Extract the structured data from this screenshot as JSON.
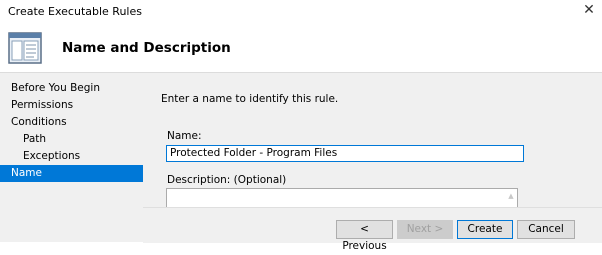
{
  "window": {
    "title": "Create Executable Rules"
  },
  "header": {
    "title": "Name and Description",
    "icon": "wizard-page-icon"
  },
  "nav": {
    "items": [
      {
        "label": "Before You Begin",
        "level": 0,
        "selected": false
      },
      {
        "label": "Permissions",
        "level": 0,
        "selected": false
      },
      {
        "label": "Conditions",
        "level": 0,
        "selected": false
      },
      {
        "label": "Path",
        "level": 1,
        "selected": false
      },
      {
        "label": "Exceptions",
        "level": 1,
        "selected": false
      },
      {
        "label": "Name",
        "level": 0,
        "selected": true
      }
    ]
  },
  "content": {
    "prompt": "Enter a name to identify this rule.",
    "name_label": "Name:",
    "name_value": "Protected Folder - Program Files",
    "description_label": "Description: (Optional)",
    "description_value": ""
  },
  "buttons": {
    "previous": "< Previous",
    "next": "Next >",
    "create": "Create",
    "cancel": "Cancel"
  },
  "colors": {
    "accent": "#0078d7",
    "panel": "#f0f0f0"
  }
}
